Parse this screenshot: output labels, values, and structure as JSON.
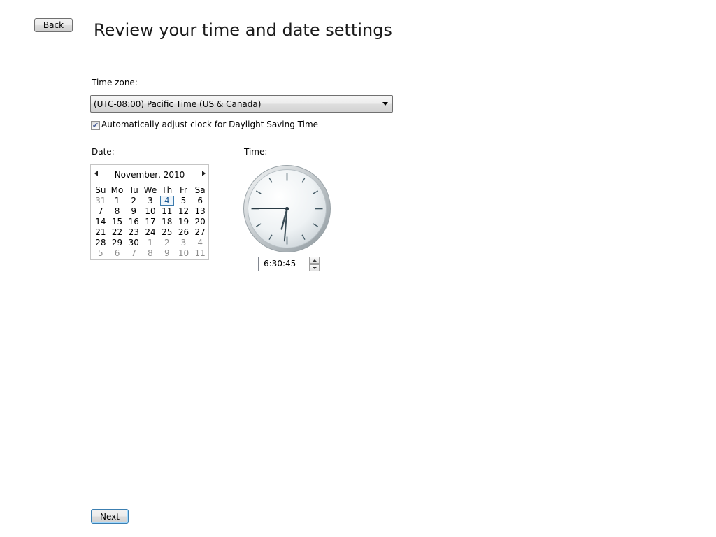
{
  "header": {
    "back_label": "Back",
    "title": "Review your time and date settings"
  },
  "timezone": {
    "label": "Time zone:",
    "selected": "(UTC-08:00) Pacific Time (US & Canada)",
    "dst_checked": true,
    "dst_label": "Automatically adjust clock for Daylight Saving Time"
  },
  "date": {
    "label": "Date:",
    "month_year": "November, 2010",
    "weekdays": [
      "Su",
      "Mo",
      "Tu",
      "We",
      "Th",
      "Fr",
      "Sa"
    ],
    "weeks": [
      [
        "31",
        "1",
        "2",
        "3",
        "4",
        "5",
        "6"
      ],
      [
        "7",
        "8",
        "9",
        "10",
        "11",
        "12",
        "13"
      ],
      [
        "14",
        "15",
        "16",
        "17",
        "18",
        "19",
        "20"
      ],
      [
        "21",
        "22",
        "23",
        "24",
        "25",
        "26",
        "27"
      ],
      [
        "28",
        "29",
        "30",
        "1",
        "2",
        "3",
        "4"
      ],
      [
        "5",
        "6",
        "7",
        "8",
        "9",
        "10",
        "11"
      ]
    ],
    "selected_day": "4"
  },
  "time": {
    "label": "Time:",
    "value": "6:30:45",
    "hours": 6,
    "minutes": 30,
    "seconds": 45
  },
  "footer": {
    "next_label": "Next"
  },
  "colors": {
    "accent": "#3d7bad",
    "other_month": "#8d8d8d"
  }
}
